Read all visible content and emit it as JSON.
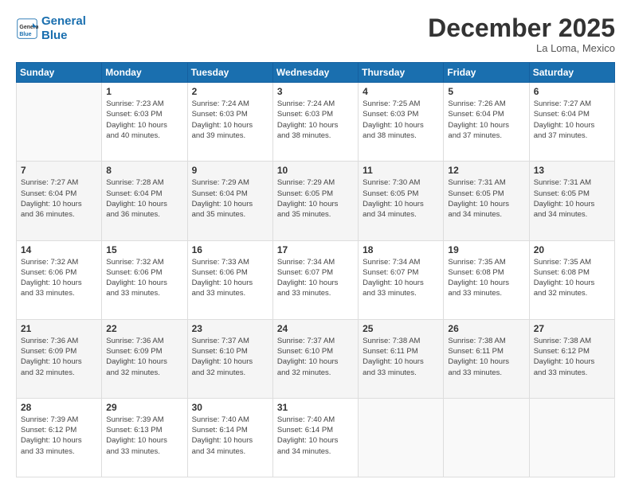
{
  "logo": {
    "line1": "General",
    "line2": "Blue"
  },
  "title": "December 2025",
  "subtitle": "La Loma, Mexico",
  "days_header": [
    "Sunday",
    "Monday",
    "Tuesday",
    "Wednesday",
    "Thursday",
    "Friday",
    "Saturday"
  ],
  "weeks": [
    [
      {
        "num": "",
        "info": ""
      },
      {
        "num": "1",
        "info": "Sunrise: 7:23 AM\nSunset: 6:03 PM\nDaylight: 10 hours\nand 40 minutes."
      },
      {
        "num": "2",
        "info": "Sunrise: 7:24 AM\nSunset: 6:03 PM\nDaylight: 10 hours\nand 39 minutes."
      },
      {
        "num": "3",
        "info": "Sunrise: 7:24 AM\nSunset: 6:03 PM\nDaylight: 10 hours\nand 38 minutes."
      },
      {
        "num": "4",
        "info": "Sunrise: 7:25 AM\nSunset: 6:03 PM\nDaylight: 10 hours\nand 38 minutes."
      },
      {
        "num": "5",
        "info": "Sunrise: 7:26 AM\nSunset: 6:04 PM\nDaylight: 10 hours\nand 37 minutes."
      },
      {
        "num": "6",
        "info": "Sunrise: 7:27 AM\nSunset: 6:04 PM\nDaylight: 10 hours\nand 37 minutes."
      }
    ],
    [
      {
        "num": "7",
        "info": "Sunrise: 7:27 AM\nSunset: 6:04 PM\nDaylight: 10 hours\nand 36 minutes."
      },
      {
        "num": "8",
        "info": "Sunrise: 7:28 AM\nSunset: 6:04 PM\nDaylight: 10 hours\nand 36 minutes."
      },
      {
        "num": "9",
        "info": "Sunrise: 7:29 AM\nSunset: 6:04 PM\nDaylight: 10 hours\nand 35 minutes."
      },
      {
        "num": "10",
        "info": "Sunrise: 7:29 AM\nSunset: 6:05 PM\nDaylight: 10 hours\nand 35 minutes."
      },
      {
        "num": "11",
        "info": "Sunrise: 7:30 AM\nSunset: 6:05 PM\nDaylight: 10 hours\nand 34 minutes."
      },
      {
        "num": "12",
        "info": "Sunrise: 7:31 AM\nSunset: 6:05 PM\nDaylight: 10 hours\nand 34 minutes."
      },
      {
        "num": "13",
        "info": "Sunrise: 7:31 AM\nSunset: 6:05 PM\nDaylight: 10 hours\nand 34 minutes."
      }
    ],
    [
      {
        "num": "14",
        "info": "Sunrise: 7:32 AM\nSunset: 6:06 PM\nDaylight: 10 hours\nand 33 minutes."
      },
      {
        "num": "15",
        "info": "Sunrise: 7:32 AM\nSunset: 6:06 PM\nDaylight: 10 hours\nand 33 minutes."
      },
      {
        "num": "16",
        "info": "Sunrise: 7:33 AM\nSunset: 6:06 PM\nDaylight: 10 hours\nand 33 minutes."
      },
      {
        "num": "17",
        "info": "Sunrise: 7:34 AM\nSunset: 6:07 PM\nDaylight: 10 hours\nand 33 minutes."
      },
      {
        "num": "18",
        "info": "Sunrise: 7:34 AM\nSunset: 6:07 PM\nDaylight: 10 hours\nand 33 minutes."
      },
      {
        "num": "19",
        "info": "Sunrise: 7:35 AM\nSunset: 6:08 PM\nDaylight: 10 hours\nand 33 minutes."
      },
      {
        "num": "20",
        "info": "Sunrise: 7:35 AM\nSunset: 6:08 PM\nDaylight: 10 hours\nand 32 minutes."
      }
    ],
    [
      {
        "num": "21",
        "info": "Sunrise: 7:36 AM\nSunset: 6:09 PM\nDaylight: 10 hours\nand 32 minutes."
      },
      {
        "num": "22",
        "info": "Sunrise: 7:36 AM\nSunset: 6:09 PM\nDaylight: 10 hours\nand 32 minutes."
      },
      {
        "num": "23",
        "info": "Sunrise: 7:37 AM\nSunset: 6:10 PM\nDaylight: 10 hours\nand 32 minutes."
      },
      {
        "num": "24",
        "info": "Sunrise: 7:37 AM\nSunset: 6:10 PM\nDaylight: 10 hours\nand 32 minutes."
      },
      {
        "num": "25",
        "info": "Sunrise: 7:38 AM\nSunset: 6:11 PM\nDaylight: 10 hours\nand 33 minutes."
      },
      {
        "num": "26",
        "info": "Sunrise: 7:38 AM\nSunset: 6:11 PM\nDaylight: 10 hours\nand 33 minutes."
      },
      {
        "num": "27",
        "info": "Sunrise: 7:38 AM\nSunset: 6:12 PM\nDaylight: 10 hours\nand 33 minutes."
      }
    ],
    [
      {
        "num": "28",
        "info": "Sunrise: 7:39 AM\nSunset: 6:12 PM\nDaylight: 10 hours\nand 33 minutes."
      },
      {
        "num": "29",
        "info": "Sunrise: 7:39 AM\nSunset: 6:13 PM\nDaylight: 10 hours\nand 33 minutes."
      },
      {
        "num": "30",
        "info": "Sunrise: 7:40 AM\nSunset: 6:14 PM\nDaylight: 10 hours\nand 34 minutes."
      },
      {
        "num": "31",
        "info": "Sunrise: 7:40 AM\nSunset: 6:14 PM\nDaylight: 10 hours\nand 34 minutes."
      },
      {
        "num": "",
        "info": ""
      },
      {
        "num": "",
        "info": ""
      },
      {
        "num": "",
        "info": ""
      }
    ]
  ]
}
